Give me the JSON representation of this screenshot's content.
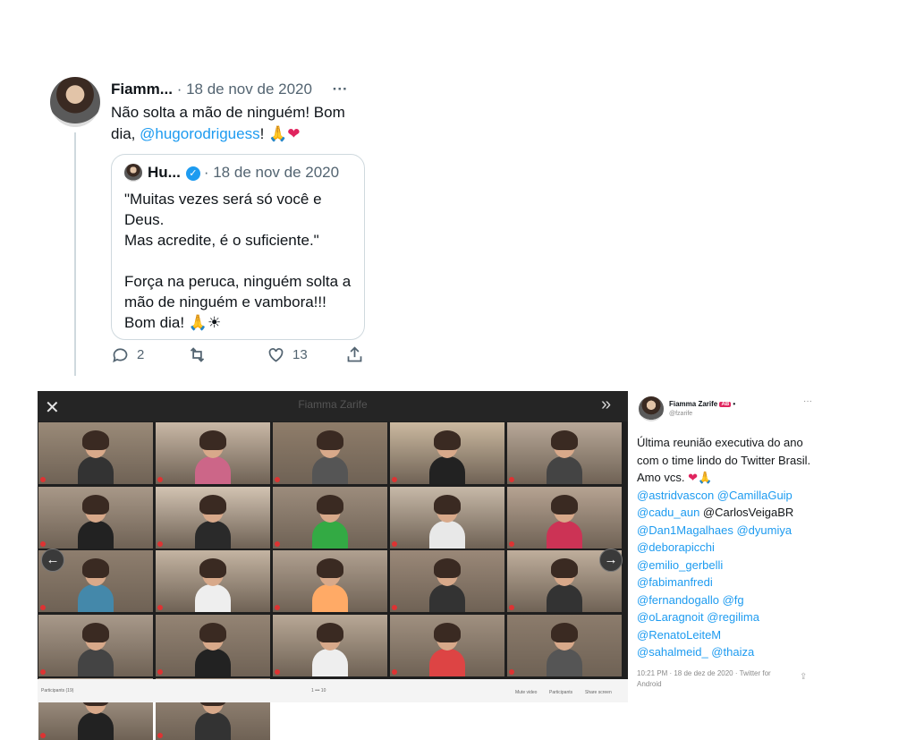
{
  "tweet": {
    "author": "Fiamm...",
    "date": "· 18 de nov de 2020",
    "more": "···",
    "text_line1": "Não solta a mão de ninguém! Bom",
    "text_pre": "dia, ",
    "mention": "@hugorodriguess",
    "text_post": "! ",
    "emoji_pray": "🙏",
    "emoji_heart": "❤",
    "quote": {
      "author": "Hu...",
      "verified_glyph": "✓",
      "date": "· 18 de nov de 2020",
      "text": "\"Muitas vezes será só você e\nDeus.\nMas acredite, é o suficiente.\"\n\nForça na peruca, ninguém solta a\nmão de ninguém e vambora!!!\nBom dia! 🙏☀"
    },
    "actions": {
      "replies": "2",
      "retweets": "",
      "likes": "13"
    }
  },
  "call": {
    "title": "Fiamma Zarife",
    "close": "✕",
    "next": "»",
    "left_arrow": "←",
    "right_arrow": "→",
    "tile_colors": [
      "#9a8a78",
      "#c9b8a6",
      "#8f7d6a",
      "#cbb9a0",
      "#b8a898",
      "#a89888",
      "#d2c3b2",
      "#9c8c7c",
      "#c7b9a8",
      "#b6a392",
      "#8e7e6e",
      "#c4b4a2",
      "#b0a090",
      "#9a8878",
      "#bfae9c",
      "#a8998a",
      "#948474",
      "#b8a896",
      "#a09080",
      "#8c7c6c",
      "#b4a494",
      "#9e8e7e"
    ],
    "tile_shirts": [
      "#333",
      "#c68",
      "#555",
      "#222",
      "#444",
      "#222",
      "#2a2a2a",
      "#3a4",
      "#e8e8e8",
      "#c35",
      "#48a",
      "#eee",
      "#fa6",
      "#333",
      "#333",
      "#444",
      "#222",
      "#eee",
      "#d44",
      "#555",
      "#222",
      "#333"
    ],
    "bottom_left": "Participants (19)",
    "bottom_mid": "1   •••   10",
    "bottom_controls": [
      "Mute video",
      "Participants",
      "Share screen"
    ]
  },
  "side": {
    "name": "Fiamma Zarife",
    "badge": "AB",
    "verified": "•",
    "handle": "@fzarife",
    "more": "···",
    "text_main": "Última reunião executiva do ano com o time lindo do Twitter Brasil. Amo vcs. ",
    "emoji_heart": "❤",
    "emoji_pray": "🙏",
    "mentions_line1": "@astridvascon @CamillaGuip",
    "mentions_line2a": "@cadu_aun",
    "mentions_line2b": " @CarlosVeigaBR",
    "mentions_line3": "@Dan1Magalhaes @dyumiya",
    "mentions_line4": "@deborapicchi",
    "mentions_line5": "@emilio_gerbelli",
    "mentions_line6": "@fabimanfredi",
    "mentions_line7": "@fernandogallo @fg",
    "mentions_line8": "@oLaragnoit @regilima",
    "mentions_line9": "@RenatoLeiteM",
    "mentions_line10": "@sahalmeid_ @thaiza",
    "footer": "10:21 PM · 18 de dez de 2020 · Twitter for Android",
    "share": "⇪"
  }
}
